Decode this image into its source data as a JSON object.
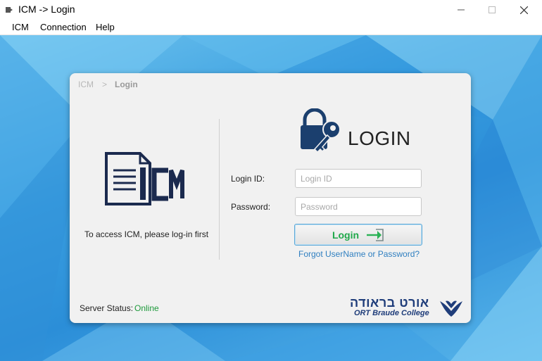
{
  "window": {
    "title": "ICM -> Login",
    "icons": {
      "app": "app-icon",
      "minimize": "minimize-icon",
      "maximize": "maximize-icon",
      "close": "close-icon"
    }
  },
  "menubar": {
    "items": [
      "ICM",
      "Connection",
      "Help"
    ]
  },
  "breadcrumb": {
    "root": "ICM",
    "separator": ">",
    "current": "Login"
  },
  "left_panel": {
    "logo_icon": "icm-document-logo",
    "access_text": "To access ICM, please log-in first"
  },
  "login": {
    "heading": "LOGIN",
    "heading_icon": "lock-key-icon",
    "id_label": "Login ID:",
    "id_placeholder": "Login ID",
    "id_value": "",
    "password_label": "Password:",
    "password_placeholder": "Password",
    "password_value": "",
    "button_label": "Login",
    "button_icon": "login-arrow-icon",
    "forgot_link": "Forgot UserName or Password?"
  },
  "status": {
    "label": "Server Status:",
    "value": "Online",
    "value_color": "#1f9a3c"
  },
  "footer_logo": {
    "hebrew": "אורט בראודה",
    "english": "ORT Braude College",
    "mark_icon": "ort-mark-icon"
  },
  "colors": {
    "accent": "#2f7fc0",
    "brand_navy": "#1f3d7a",
    "button_label": "#1fa84a",
    "background": "#2b8ed8"
  }
}
